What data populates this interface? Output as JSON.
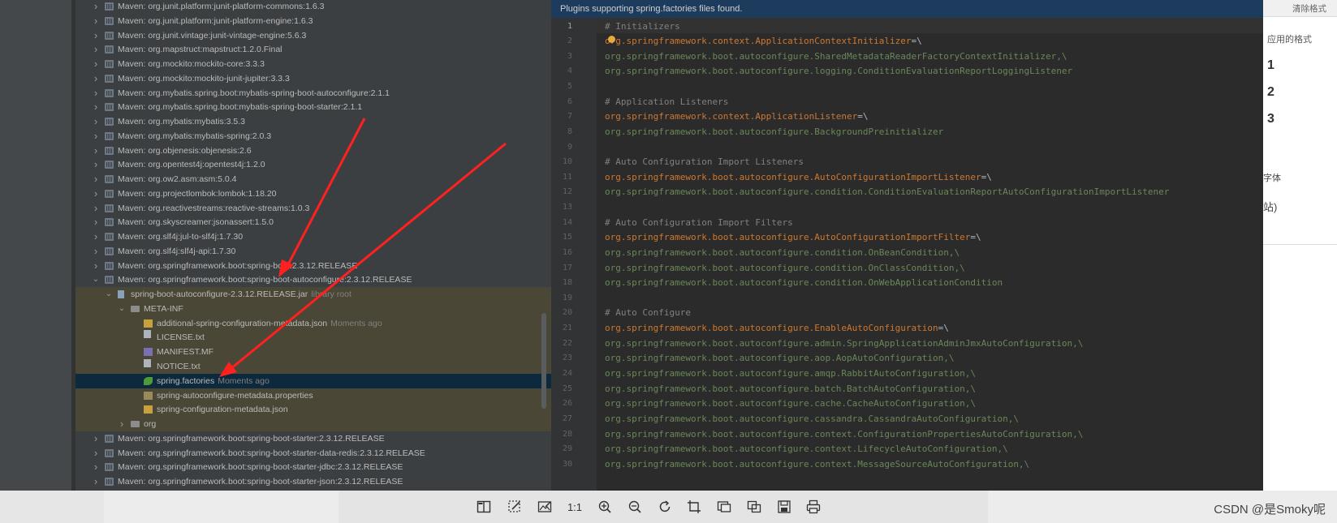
{
  "tree": {
    "rows": [
      {
        "label": "Maven: org.junit.platform:junit-platform-commons:1.6.3"
      },
      {
        "label": "Maven: org.junit.platform:junit-platform-engine:1.6.3"
      },
      {
        "label": "Maven: org.junit.vintage:junit-vintage-engine:5.6.3"
      },
      {
        "label": "Maven: org.mapstruct:mapstruct:1.2.0.Final"
      },
      {
        "label": "Maven: org.mockito:mockito-core:3.3.3"
      },
      {
        "label": "Maven: org.mockito:mockito-junit-jupiter:3.3.3"
      },
      {
        "label": "Maven: org.mybatis.spring.boot:mybatis-spring-boot-autoconfigure:2.1.1"
      },
      {
        "label": "Maven: org.mybatis.spring.boot:mybatis-spring-boot-starter:2.1.1"
      },
      {
        "label": "Maven: org.mybatis:mybatis:3.5.3"
      },
      {
        "label": "Maven: org.mybatis:mybatis-spring:2.0.3"
      },
      {
        "label": "Maven: org.objenesis:objenesis:2.6"
      },
      {
        "label": "Maven: org.opentest4j:opentest4j:1.2.0"
      },
      {
        "label": "Maven: org.ow2.asm:asm:5.0.4"
      },
      {
        "label": "Maven: org.projectlombok:lombok:1.18.20"
      },
      {
        "label": "Maven: org.reactivestreams:reactive-streams:1.0.3"
      },
      {
        "label": "Maven: org.skyscreamer:jsonassert:1.5.0"
      },
      {
        "label": "Maven: org.slf4j:jul-to-slf4j:1.7.30"
      },
      {
        "label": "Maven: org.slf4j:slf4j-api:1.7.30"
      },
      {
        "label": "Maven: org.springframework.boot:spring-boot:2.3.12.RELEASE"
      },
      {
        "label": "Maven: org.springframework.boot:spring-boot-autoconfigure:2.3.12.RELEASE"
      },
      {
        "label": "spring-boot-autoconfigure-2.3.12.RELEASE.jar",
        "hint": "library root"
      },
      {
        "label": "META-INF"
      },
      {
        "label": "additional-spring-configuration-metadata.json",
        "hint": "Moments ago"
      },
      {
        "label": "LICENSE.txt"
      },
      {
        "label": "MANIFEST.MF"
      },
      {
        "label": "NOTICE.txt"
      },
      {
        "label": "spring.factories",
        "hint": "Moments ago"
      },
      {
        "label": "spring-autoconfigure-metadata.properties"
      },
      {
        "label": "spring-configuration-metadata.json"
      },
      {
        "label": "org"
      },
      {
        "label": "Maven: org.springframework.boot:spring-boot-starter:2.3.12.RELEASE"
      },
      {
        "label": "Maven: org.springframework.boot:spring-boot-starter-data-redis:2.3.12.RELEASE"
      },
      {
        "label": "Maven: org.springframework.boot:spring-boot-starter-jdbc:2.3.12.RELEASE"
      },
      {
        "label": "Maven: org.springframework.boot:spring-boot-starter-json:2.3.12.RELEASE"
      }
    ]
  },
  "editor": {
    "banner": "Plugins supporting spring.factories files found.",
    "lines": [
      {
        "n": "1",
        "k": "comment",
        "t": "# Initializers"
      },
      {
        "n": "2",
        "k": "key",
        "t": "org.springframework.context.ApplicationContextInitializer",
        "s": "=\\"
      },
      {
        "n": "3",
        "k": "val",
        "t": "org.springframework.boot.autoconfigure.SharedMetadataReaderFactoryContextInitializer,\\"
      },
      {
        "n": "4",
        "k": "val",
        "t": "org.springframework.boot.autoconfigure.logging.ConditionEvaluationReportLoggingListener"
      },
      {
        "n": "5",
        "k": "val",
        "t": ""
      },
      {
        "n": "6",
        "k": "comment",
        "t": "# Application Listeners"
      },
      {
        "n": "7",
        "k": "key",
        "t": "org.springframework.context.ApplicationListener",
        "s": "=\\"
      },
      {
        "n": "8",
        "k": "val",
        "t": "org.springframework.boot.autoconfigure.BackgroundPreinitializer"
      },
      {
        "n": "9",
        "k": "val",
        "t": ""
      },
      {
        "n": "10",
        "k": "comment",
        "t": "# Auto Configuration Import Listeners"
      },
      {
        "n": "11",
        "k": "key",
        "t": "org.springframework.boot.autoconfigure.AutoConfigurationImportListener",
        "s": "=\\"
      },
      {
        "n": "12",
        "k": "val",
        "t": "org.springframework.boot.autoconfigure.condition.ConditionEvaluationReportAutoConfigurationImportListener"
      },
      {
        "n": "13",
        "k": "val",
        "t": ""
      },
      {
        "n": "14",
        "k": "comment",
        "t": "# Auto Configuration Import Filters"
      },
      {
        "n": "15",
        "k": "key",
        "t": "org.springframework.boot.autoconfigure.AutoConfigurationImportFilter",
        "s": "=\\"
      },
      {
        "n": "16",
        "k": "val",
        "t": "org.springframework.boot.autoconfigure.condition.OnBeanCondition,\\"
      },
      {
        "n": "17",
        "k": "val",
        "t": "org.springframework.boot.autoconfigure.condition.OnClassCondition,\\"
      },
      {
        "n": "18",
        "k": "val",
        "t": "org.springframework.boot.autoconfigure.condition.OnWebApplicationCondition"
      },
      {
        "n": "19",
        "k": "val",
        "t": ""
      },
      {
        "n": "20",
        "k": "comment",
        "t": "# Auto Configure"
      },
      {
        "n": "21",
        "k": "key",
        "t": "org.springframework.boot.autoconfigure.EnableAutoConfiguration",
        "s": "=\\"
      },
      {
        "n": "22",
        "k": "val",
        "t": "org.springframework.boot.autoconfigure.admin.SpringApplicationAdminJmxAutoConfiguration,\\"
      },
      {
        "n": "23",
        "k": "val",
        "t": "org.springframework.boot.autoconfigure.aop.AopAutoConfiguration,\\"
      },
      {
        "n": "24",
        "k": "val",
        "t": "org.springframework.boot.autoconfigure.amqp.RabbitAutoConfiguration,\\"
      },
      {
        "n": "25",
        "k": "val",
        "t": "org.springframework.boot.autoconfigure.batch.BatchAutoConfiguration,\\"
      },
      {
        "n": "26",
        "k": "val",
        "t": "org.springframework.boot.autoconfigure.cache.CacheAutoConfiguration,\\"
      },
      {
        "n": "27",
        "k": "val",
        "t": "org.springframework.boot.autoconfigure.cassandra.CassandraAutoConfiguration,\\"
      },
      {
        "n": "28",
        "k": "val",
        "t": "org.springframework.boot.autoconfigure.context.ConfigurationPropertiesAutoConfiguration,\\"
      },
      {
        "n": "29",
        "k": "val",
        "t": "org.springframework.boot.autoconfigure.context.LifecycleAutoConfiguration,\\"
      },
      {
        "n": "30",
        "k": "val",
        "t": "org.springframework.boot.autoconfigure.context.MessageSourceAutoConfiguration,\\"
      }
    ]
  },
  "right_panel": {
    "clear_label": "清除格式",
    "style_label": "应用的格式",
    "numbers": [
      "1",
      "2",
      "3"
    ],
    "font_label": "字体",
    "site_label": "站)"
  },
  "bottom": {
    "watermark": "CSDN @是Smoky呢",
    "tools": [
      "split-view-icon",
      "magic-select-icon",
      "edit-image-icon",
      "actual-size-icon",
      "zoom-in-icon",
      "zoom-out-icon",
      "rotate-icon",
      "crop-icon",
      "image-window-icon",
      "compare-icon",
      "save-icon",
      "print-icon"
    ],
    "actual_size_text": "1:1"
  },
  "colors": {
    "annotation_arrow": "#ff2020",
    "selected_row": "#0d293e",
    "library_highlight": "#4a4736"
  }
}
